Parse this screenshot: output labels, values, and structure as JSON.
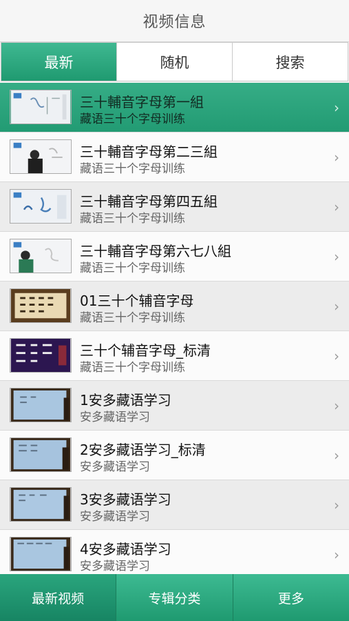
{
  "nav": {
    "title": "视频信息"
  },
  "segments": [
    {
      "label": "最新"
    },
    {
      "label": "随机"
    },
    {
      "label": "搜索"
    }
  ],
  "videos": [
    {
      "title": "三十輔音字母第一組",
      "subtitle": "藏语三十个字母训练",
      "thumb": "whiteboard-thumbnail"
    },
    {
      "title": "三十輔音字母第二三組",
      "subtitle": "藏语三十个字母训练",
      "thumb": "teacher-whiteboard-thumbnail"
    },
    {
      "title": "三十輔音字母第四五組",
      "subtitle": "藏语三十个字母训练",
      "thumb": "letters-whiteboard-thumbnail"
    },
    {
      "title": "三十輔音字母第六七八組",
      "subtitle": "藏语三十个字母训练",
      "thumb": "teacher-whiteboard-thumbnail"
    },
    {
      "title": "01三十个辅音字母",
      "subtitle": "藏语三十个字母训练",
      "thumb": "scroll-thumbnail"
    },
    {
      "title": "三十个辅音字母_标清",
      "subtitle": "藏语三十个字母训练",
      "thumb": "dark-slide-thumbnail"
    },
    {
      "title": "1安多藏语学习",
      "subtitle": "安多藏语学习",
      "thumb": "classroom-board-thumbnail"
    },
    {
      "title": "2安多藏语学习_标清",
      "subtitle": "安多藏语学习",
      "thumb": "classroom-board-thumbnail"
    },
    {
      "title": "3安多藏语学习",
      "subtitle": "安多藏语学习",
      "thumb": "classroom-board-thumbnail"
    },
    {
      "title": "4安多藏语学习",
      "subtitle": "安多藏语学习",
      "thumb": "classroom-board-thumbnail"
    }
  ],
  "tabbar": [
    {
      "label": "最新视频"
    },
    {
      "label": "专辑分类"
    },
    {
      "label": "更多"
    }
  ],
  "colors": {
    "accent": "#2aa57d",
    "accent_dark": "#1f9a70"
  }
}
